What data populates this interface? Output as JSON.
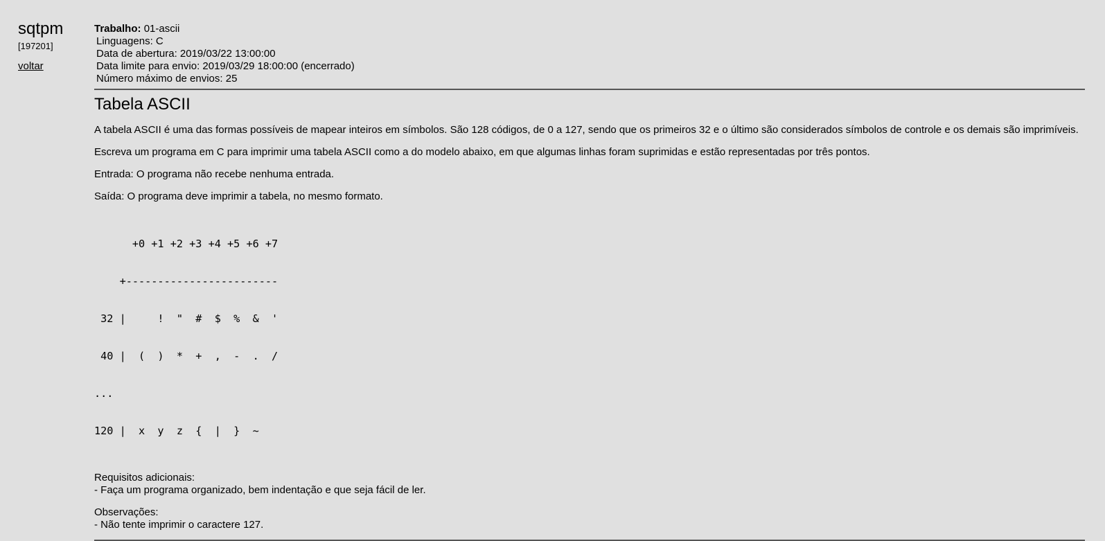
{
  "sidebar": {
    "title": "sqtpm",
    "code": "[197201]",
    "back_label": "voltar"
  },
  "job": {
    "label": "Trabalho:",
    "name": "01-ascii",
    "info": [
      "Linguagens: C",
      "Data de abertura: 2019/03/22 13:00:00",
      "Data limite para envio: 2019/03/29 18:00:00 (encerrado)",
      "Número máximo de envios: 25"
    ]
  },
  "statement": {
    "title": "Tabela ASCII",
    "paragraphs": [
      "A tabela ASCII é uma das formas possíveis de mapear inteiros em símbolos. São 128 códigos, de 0 a 127, sendo que os primeiros 32 e o último são considerados símbolos de controle e os demais são imprimíveis.",
      "Escreva um programa em C para imprimir uma tabela ASCII como a do modelo abaixo, em que algumas linhas foram suprimidas e estão representadas por três pontos.",
      "Entrada: O programa não recebe nenhuma entrada.",
      "Saída: O programa deve imprimir a tabela, no mesmo formato."
    ],
    "table_lines": [
      "      +0 +1 +2 +3 +4 +5 +6 +7",
      "    +------------------------",
      " 32 |     !  \"  #  $  %  &  '",
      " 40 |  (  )  *  +  ,  -  .  /",
      "...",
      "120 |  x  y  z  {  |  }  ~"
    ],
    "requirements_title": "Requisitos adicionais:",
    "requirements": [
      "- Faça um programa organizado, bem indentação e que seja fácil de ler."
    ],
    "notes_title": "Observações:",
    "notes": [
      "- Não tente imprimir o caractere 127."
    ]
  }
}
